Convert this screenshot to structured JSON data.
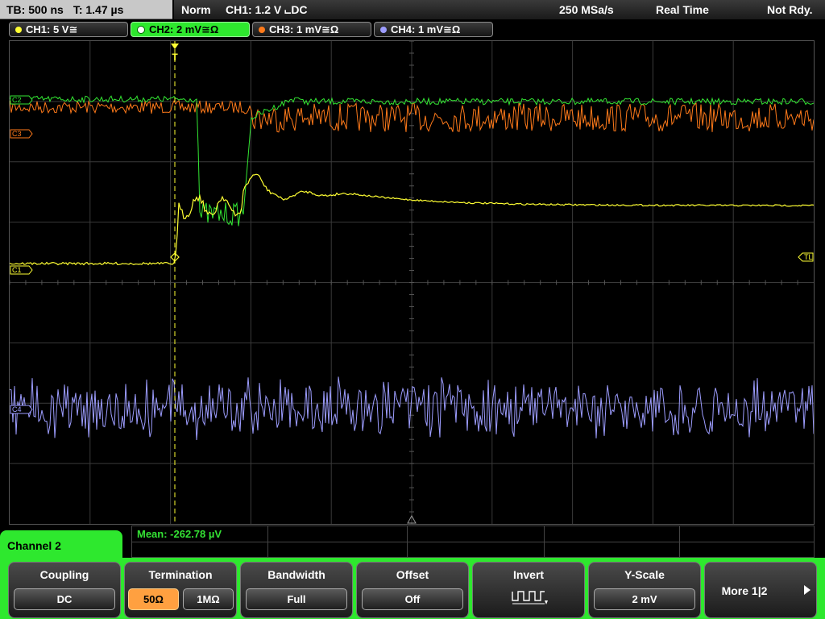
{
  "header": {
    "timebase": "TB: 500 ns",
    "trigger_time": "T: 1.47 µs",
    "mode": "Norm",
    "trigger_setting": "CH1: 1.2 V ⨽DC",
    "sample_rate": "250 MSa/s",
    "acq_mode": "Real Time",
    "status": "Not Rdy."
  },
  "channels": [
    {
      "label": "CH1: 5 V≅",
      "color": "#ffff33",
      "active": false
    },
    {
      "label": "CH2: 2 mV≅Ω",
      "color": "#22d322",
      "active": true
    },
    {
      "label": "CH3: 1 mV≅Ω",
      "color": "#ff7a1a",
      "active": false
    },
    {
      "label": "CH4: 1 mV≅Ω",
      "color": "#9d9dff",
      "active": false
    }
  ],
  "markers": {
    "c1": "C1",
    "c2": "C2",
    "c3": "C3",
    "c4": "C4",
    "trigger_level": "TL",
    "trigger_pos": "T"
  },
  "colors": {
    "ch1": "#ffff33",
    "ch2": "#33e833",
    "ch3": "#ff7a1a",
    "ch4": "#9d9dff",
    "grid": "#3a3a3a",
    "menu_accent": "#2ee82e",
    "selected_option": "#ffa040"
  },
  "measurement": {
    "mean": "Mean: -262.78 µV"
  },
  "menu": {
    "title": "Channel 2",
    "keys": [
      {
        "label": "Coupling",
        "value": "DC"
      },
      {
        "label": "Termination",
        "options": [
          "50Ω",
          "1MΩ"
        ],
        "selected": "50Ω"
      },
      {
        "label": "Bandwidth",
        "value": "Full"
      },
      {
        "label": "Offset",
        "value": "Off"
      },
      {
        "label": "Invert",
        "icon": "inverted-square-wave-icon"
      },
      {
        "label": "Y-Scale",
        "value": "2 mV"
      },
      {
        "label": "More 1|2",
        "icon": "play-arrow-icon"
      }
    ]
  }
}
